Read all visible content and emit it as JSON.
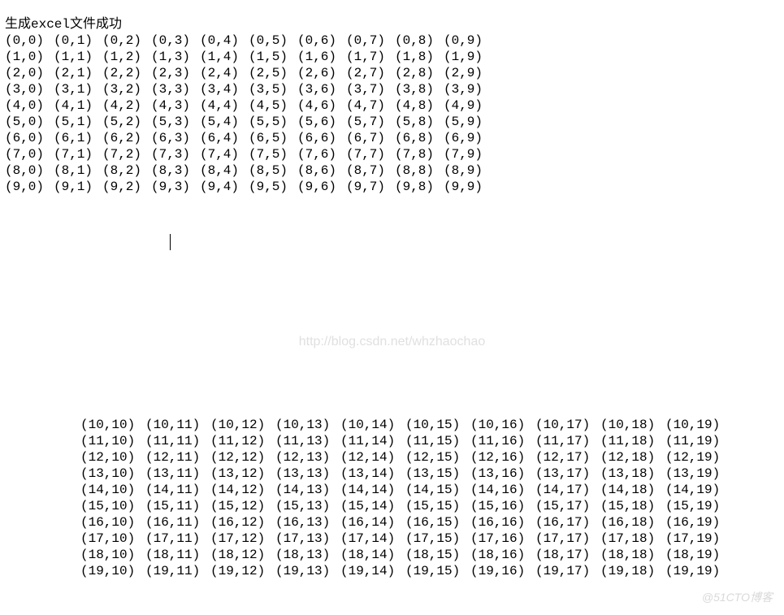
{
  "header_line": "生成excel文件成功",
  "grid1": {
    "row_start": 0,
    "row_end": 9,
    "col_start": 0,
    "col_end": 9
  },
  "grid2": {
    "row_start": 10,
    "row_end": 19,
    "col_start": 10,
    "col_end": 19
  },
  "watermark_center": "http://blog.csdn.net/whzhaochao",
  "watermark_corner": "@51CTO博客"
}
